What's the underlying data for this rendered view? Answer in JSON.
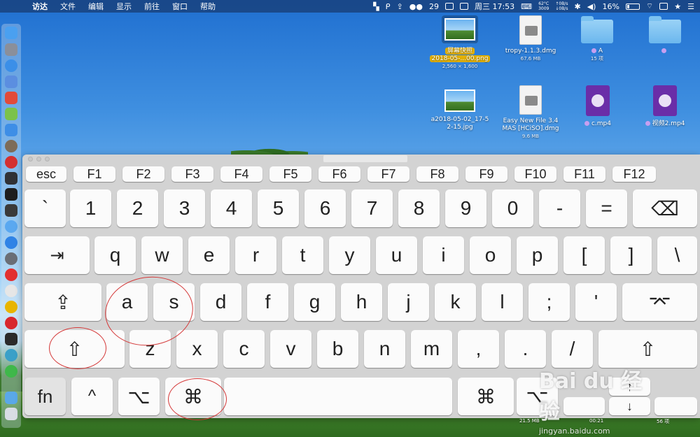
{
  "menubar": {
    "apple": "",
    "items": [
      "访达",
      "文件",
      "编辑",
      "显示",
      "前往",
      "窗口",
      "帮助"
    ],
    "status": {
      "wechat_count": "29",
      "clock": "周三 17:53",
      "cpu_temp": "62°C",
      "cpu_freq": "3009",
      "net_up": "0B/s",
      "net_down": "0B/s",
      "battery": "16%"
    }
  },
  "desktop": {
    "icons": [
      {
        "name": "屏幕快照",
        "name2": "2018-05-...00.png",
        "sub": "2,560 × 1,600"
      },
      {
        "name": "tropy-1.1.3.dmg",
        "sub": "67.6 MB"
      },
      {
        "name": "A",
        "sub": "15 项"
      },
      {
        "name": "a2018-05-02_17-5",
        "name2": "2-15.jpg"
      },
      {
        "name": "Easy New File 3.4",
        "name2": "MAS [HCiSO].dmg",
        "sub": "9.6 MB"
      },
      {
        "name": "c.mp4"
      },
      {
        "name": "视频2.mp4"
      }
    ],
    "bottom_labels": [
      "21.5 MB",
      "00:21",
      "56 项"
    ]
  },
  "keyboard": {
    "rows": [
      [
        "esc",
        "F1",
        "F2",
        "F3",
        "F4",
        "F5",
        "F6",
        "F7",
        "F8",
        "F9",
        "F10",
        "F11",
        "F12"
      ],
      [
        "`",
        "1",
        "2",
        "3",
        "4",
        "5",
        "6",
        "7",
        "8",
        "9",
        "0",
        "-",
        "=",
        "⌫"
      ],
      [
        "⇥",
        "q",
        "w",
        "e",
        "r",
        "t",
        "y",
        "u",
        "i",
        "o",
        "p",
        "[",
        "]",
        "\\"
      ],
      [
        "⇪",
        "a",
        "s",
        "d",
        "f",
        "g",
        "h",
        "j",
        "k",
        "l",
        ";",
        "'",
        "⌤"
      ],
      [
        "⇧",
        "z",
        "x",
        "c",
        "v",
        "b",
        "n",
        "m",
        ",",
        ".",
        "/",
        "⇧"
      ],
      [
        "fn",
        "^",
        "⌥",
        "⌘",
        "",
        "⌘",
        "⌥",
        "↑",
        "←↓→"
      ]
    ],
    "bottom_row": {
      "fn": "fn",
      "ctrl": "^",
      "alt_left": "⌥",
      "cmd_left": "⌘",
      "space": "",
      "cmd_right": "⌘",
      "alt_right": "⌥",
      "up": "↑",
      "left": "",
      "down": "↓",
      "right": ""
    }
  },
  "watermark": {
    "brand": "Bai du 经验",
    "url": "jingyan.baidu.com"
  },
  "colors": {
    "annotation_circle": "#d43838",
    "key_face": "#fbfbfb",
    "keyboard_bg": "#d3d3d3"
  }
}
